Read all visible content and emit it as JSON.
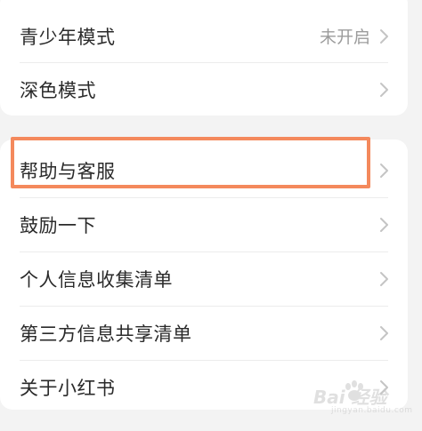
{
  "settings": {
    "group1": [
      {
        "label": "青少年模式",
        "value": "未开启"
      },
      {
        "label": "深色模式"
      }
    ],
    "group2": [
      {
        "label": "帮助与客服"
      },
      {
        "label": "鼓励一下"
      },
      {
        "label": "个人信息收集清单"
      },
      {
        "label": "第三方信息共享清单"
      },
      {
        "label": "关于小红书"
      }
    ]
  },
  "watermark": {
    "text": "Bai 经验",
    "url": "jingyan.baidu.com"
  },
  "colors": {
    "highlight": "#f4895c",
    "background": "#f3f3f3",
    "card": "#ffffff",
    "label": "#2a2a2a",
    "secondary": "#9c9c9c"
  },
  "icons": {
    "row_arrow": "chevron-right-icon",
    "watermark": "paw-icon"
  }
}
